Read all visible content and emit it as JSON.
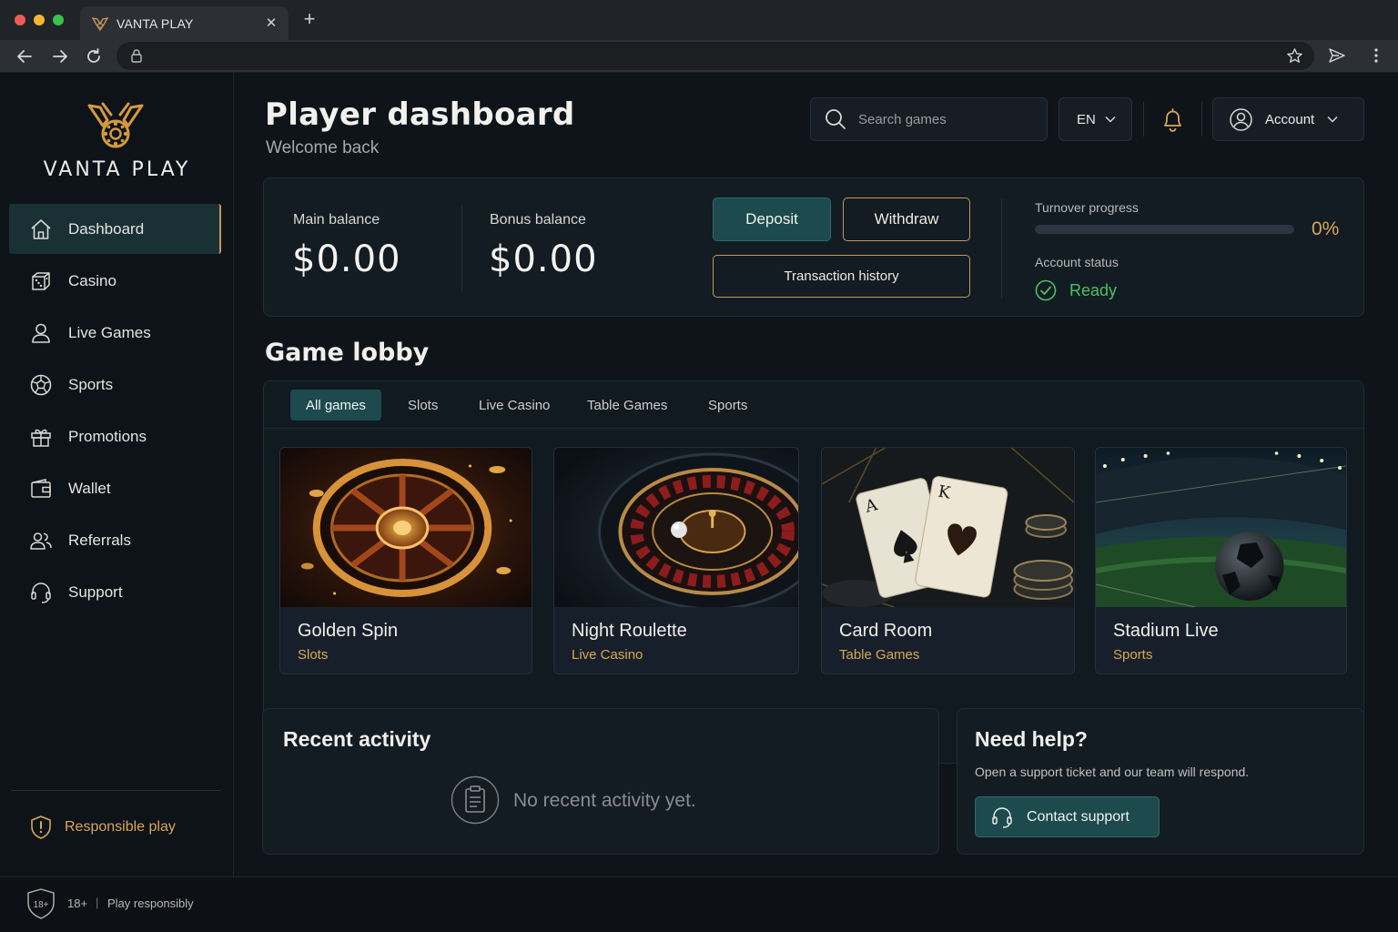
{
  "browser": {
    "tab_title": "VANTA PLAY"
  },
  "brand": {
    "name": "VANTA PLAY",
    "accent": "#c39a58",
    "teal": "#1d4a4c",
    "success": "#4cc064"
  },
  "sidebar": {
    "items": [
      {
        "label": "Dashboard",
        "icon": "home-icon",
        "active": true
      },
      {
        "label": "Casino",
        "icon": "dice-icon"
      },
      {
        "label": "Live Games",
        "icon": "user-icon"
      },
      {
        "label": "Sports",
        "icon": "soccer-ball-icon"
      },
      {
        "label": "Promotions",
        "icon": "gift-icon"
      },
      {
        "label": "Wallet",
        "icon": "wallet-icon"
      },
      {
        "label": "Referrals",
        "icon": "users-icon"
      },
      {
        "label": "Support",
        "icon": "headset-icon"
      }
    ],
    "responsible": "Responsible play"
  },
  "header": {
    "title": "Player dashboard",
    "subtitle": "Welcome back",
    "search_placeholder": "Search games",
    "language": "EN",
    "account": "Account"
  },
  "balances": {
    "main_label": "Main balance",
    "main_value": "$0.00",
    "bonus_label": "Bonus balance",
    "bonus_value": "$0.00",
    "deposit": "Deposit",
    "withdraw": "Withdraw",
    "history": "Transaction history",
    "turnover_label": "Turnover progress",
    "turnover_value": 0,
    "turnover_pct": "0%",
    "status_label": "Account status",
    "status_value": "Ready"
  },
  "lobby": {
    "title": "Game lobby",
    "tabs": [
      "All games",
      "Slots",
      "Live Casino",
      "Table Games",
      "Sports"
    ],
    "active_tab": 0,
    "games": [
      {
        "name": "Golden Spin",
        "category": "Slots"
      },
      {
        "name": "Night Roulette",
        "category": "Live Casino"
      },
      {
        "name": "Card Room",
        "category": "Table Games"
      },
      {
        "name": "Stadium Live",
        "category": "Sports"
      }
    ]
  },
  "activity": {
    "title": "Recent activity",
    "empty": "No recent activity yet."
  },
  "help": {
    "title": "Need help?",
    "text": "Open a support ticket and our team will respond.",
    "button": "Contact support"
  },
  "footer": {
    "age_badge": "18+",
    "age": "18+",
    "separator": "|",
    "note": "Play responsibly"
  }
}
